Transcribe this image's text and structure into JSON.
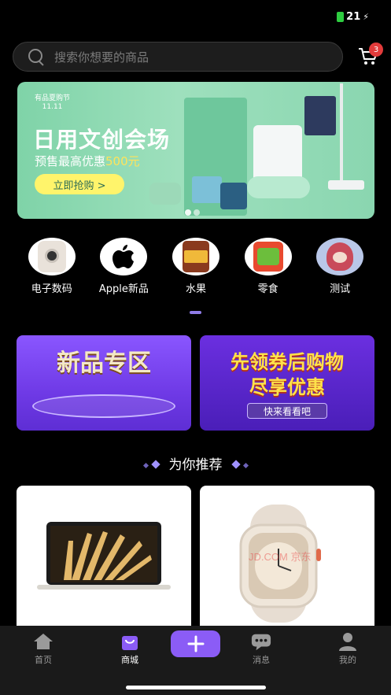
{
  "status": {
    "battery": "21"
  },
  "search": {
    "placeholder": "搜索你想要的商品"
  },
  "cart": {
    "badge": "3"
  },
  "banner": {
    "tag_line1": "有品夏购节",
    "tag_line2": "11.11",
    "title": "日用文创会场",
    "subtitle_prefix": "预售最高优惠",
    "subtitle_amount": "500元",
    "button": "立即抢购 >"
  },
  "categories": [
    {
      "label": "电子数码",
      "icon": "phone-image"
    },
    {
      "label": "Apple新品",
      "icon": "apple-logo"
    },
    {
      "label": "水果",
      "icon": "fruit-image"
    },
    {
      "label": "零食",
      "icon": "snack-image"
    },
    {
      "label": "测试",
      "icon": "test-image"
    }
  ],
  "promos": {
    "left_title": "新品专区",
    "right_title_1": "先领券后购物",
    "right_title_2": "尽享优惠",
    "right_button": "快来看看吧"
  },
  "section": {
    "title": "为你推荐"
  },
  "products": [
    {
      "name": "macbook",
      "icon": "laptop-image"
    },
    {
      "name": "watch",
      "icon": "watch-image",
      "watermark": "JD.COM 京东"
    }
  ],
  "tabbar": {
    "items": [
      {
        "label": "首页",
        "icon": "home-icon"
      },
      {
        "label": "商城",
        "icon": "shop-icon"
      },
      {
        "label": "",
        "icon": "plus-icon"
      },
      {
        "label": "消息",
        "icon": "message-icon"
      },
      {
        "label": "我的",
        "icon": "user-icon"
      }
    ],
    "accent": "#8b5cf6"
  }
}
